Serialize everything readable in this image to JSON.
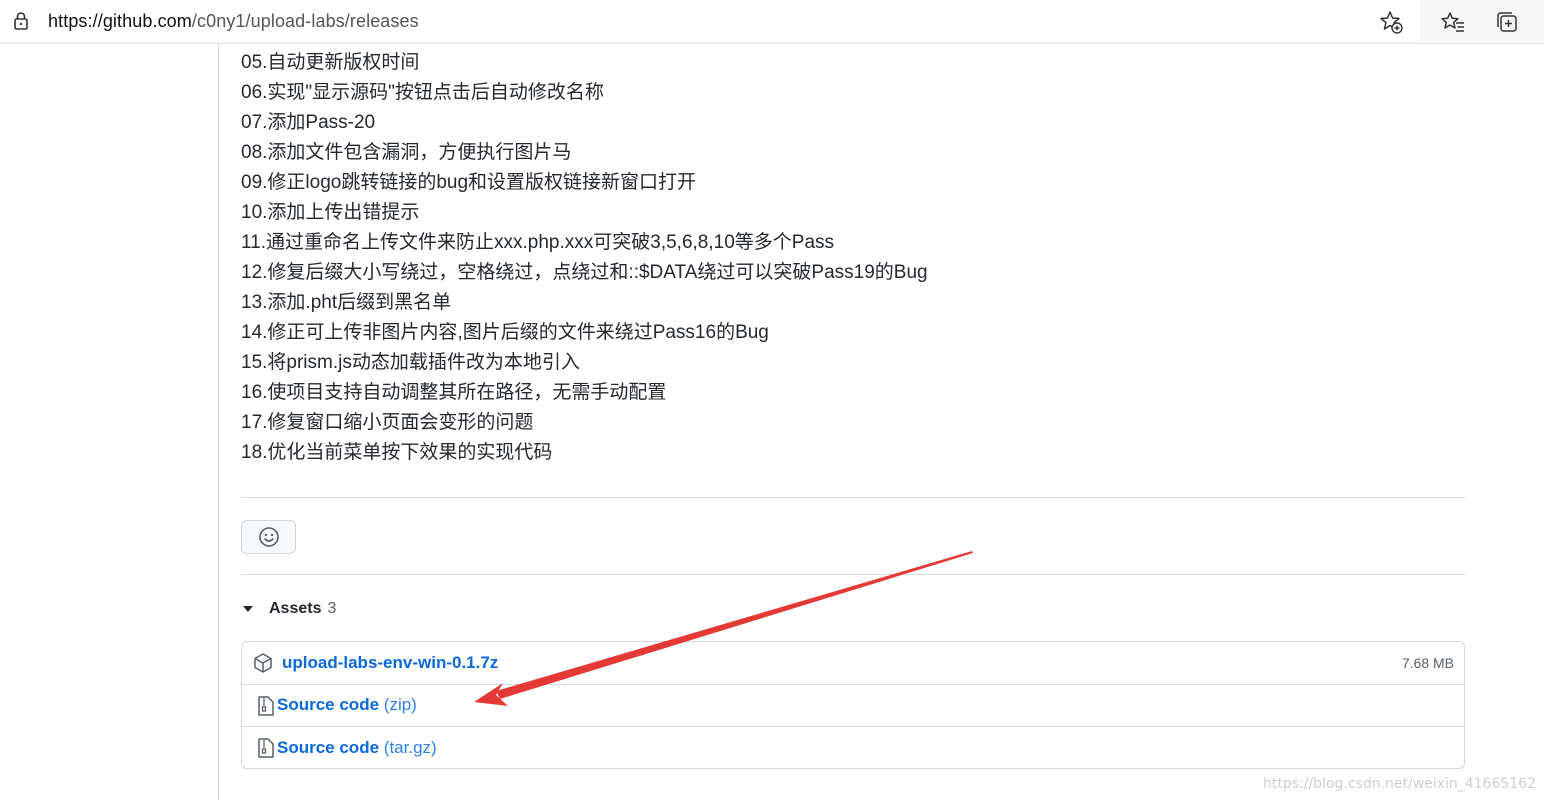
{
  "browser": {
    "url_host": "https://github.com",
    "url_path": "/c0ny1/upload-labs/releases",
    "icons": [
      "lock-icon",
      "add-favorite-icon",
      "favorites-icon",
      "collections-icon"
    ]
  },
  "release_notes": [
    "05.自动更新版权时间",
    "06.实现\"显示源码\"按钮点击后自动修改名称",
    "07.添加Pass-20",
    "08.添加文件包含漏洞，方便执行图片马",
    "09.修正logo跳转链接的bug和设置版权链接新窗口打开",
    "10.添加上传出错提示",
    "11.通过重命名上传文件来防止xxx.php.xxx可突破3,5,6,8,10等多个Pass",
    "12.修复后缀大小写绕过，空格绕过，点绕过和::$DATA绕过可以突破Pass19的Bug",
    "13.添加.pht后缀到黑名单",
    "14.修正可上传非图片内容,图片后缀的文件来绕过Pass16的Bug",
    "15.将prism.js动态加载插件改为本地引入",
    "16.使项目支持自动调整其所在路径，无需手动配置",
    "17.修复窗口缩小页面会变形的问题",
    "18.优化当前菜单按下效果的实现代码"
  ],
  "assets": {
    "title": "Assets",
    "count": "3",
    "items": [
      {
        "name": "upload-labs-env-win-0.1.7z",
        "size": "7.68 MB",
        "icon": "package-icon"
      },
      {
        "name": "Source code",
        "suffix": "(zip)",
        "icon": "file-zip-icon"
      },
      {
        "name": "Source code",
        "suffix": "(tar.gz)",
        "icon": "file-zip-icon"
      }
    ]
  },
  "annotation": {
    "color": "#e53935"
  },
  "watermark": "https://blog.csdn.net/weixin_41665162"
}
